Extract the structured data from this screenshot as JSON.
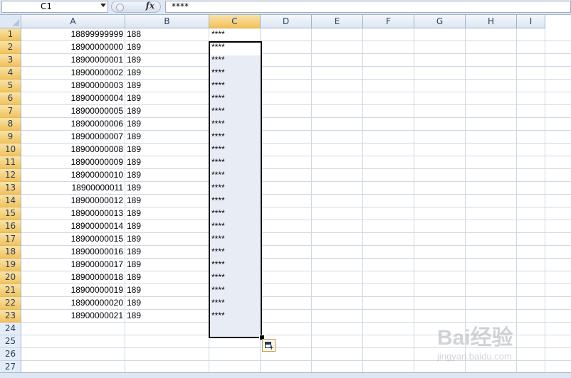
{
  "formula_bar": {
    "name_box": "C1",
    "fx_label": "fx",
    "content": "****"
  },
  "columns": [
    "A",
    "B",
    "C",
    "D",
    "E",
    "F",
    "G",
    "H",
    "I"
  ],
  "selected_column": "C",
  "rows": [
    {
      "n": "1",
      "a": "18899999999",
      "b": "188",
      "c": "****"
    },
    {
      "n": "2",
      "a": "18900000000",
      "b": "189",
      "c": "****"
    },
    {
      "n": "3",
      "a": "18900000001",
      "b": "189",
      "c": "****"
    },
    {
      "n": "4",
      "a": "18900000002",
      "b": "189",
      "c": "****"
    },
    {
      "n": "5",
      "a": "18900000003",
      "b": "189",
      "c": "****"
    },
    {
      "n": "6",
      "a": "18900000004",
      "b": "189",
      "c": "****"
    },
    {
      "n": "7",
      "a": "18900000005",
      "b": "189",
      "c": "****"
    },
    {
      "n": "8",
      "a": "18900000006",
      "b": "189",
      "c": "****"
    },
    {
      "n": "9",
      "a": "18900000007",
      "b": "189",
      "c": "****"
    },
    {
      "n": "10",
      "a": "18900000008",
      "b": "189",
      "c": "****"
    },
    {
      "n": "11",
      "a": "18900000009",
      "b": "189",
      "c": "****"
    },
    {
      "n": "12",
      "a": "18900000010",
      "b": "189",
      "c": "****"
    },
    {
      "n": "13",
      "a": "18900000011",
      "b": "189",
      "c": "****"
    },
    {
      "n": "14",
      "a": "18900000012",
      "b": "189",
      "c": "****"
    },
    {
      "n": "15",
      "a": "18900000013",
      "b": "189",
      "c": "****"
    },
    {
      "n": "16",
      "a": "18900000014",
      "b": "189",
      "c": "****"
    },
    {
      "n": "17",
      "a": "18900000015",
      "b": "189",
      "c": "****"
    },
    {
      "n": "18",
      "a": "18900000016",
      "b": "189",
      "c": "****"
    },
    {
      "n": "19",
      "a": "18900000017",
      "b": "189",
      "c": "****"
    },
    {
      "n": "20",
      "a": "18900000018",
      "b": "189",
      "c": "****"
    },
    {
      "n": "21",
      "a": "18900000019",
      "b": "189",
      "c": "****"
    },
    {
      "n": "22",
      "a": "18900000020",
      "b": "189",
      "c": "****"
    },
    {
      "n": "23",
      "a": "18900000021",
      "b": "189",
      "c": "****"
    },
    {
      "n": "24",
      "a": "",
      "b": "",
      "c": ""
    },
    {
      "n": "25",
      "a": "",
      "b": "",
      "c": ""
    },
    {
      "n": "26",
      "a": "",
      "b": "",
      "c": ""
    },
    {
      "n": "27",
      "a": "",
      "b": "",
      "c": ""
    }
  ],
  "selected_rows_count": 23,
  "watermark": {
    "line1": "Bai经验",
    "line2": "jingyan.baidu.com"
  },
  "colors": {
    "header_bg": "#dfe8f5",
    "selected_header": "#f2c25b",
    "grid_line": "#d0d7e5",
    "selection_fill": "#e8ecf5"
  },
  "icons": {
    "name_box_dropdown": "chevron-down-icon",
    "function": "fx-icon",
    "autofill_options": "auto-fill-options-icon"
  }
}
